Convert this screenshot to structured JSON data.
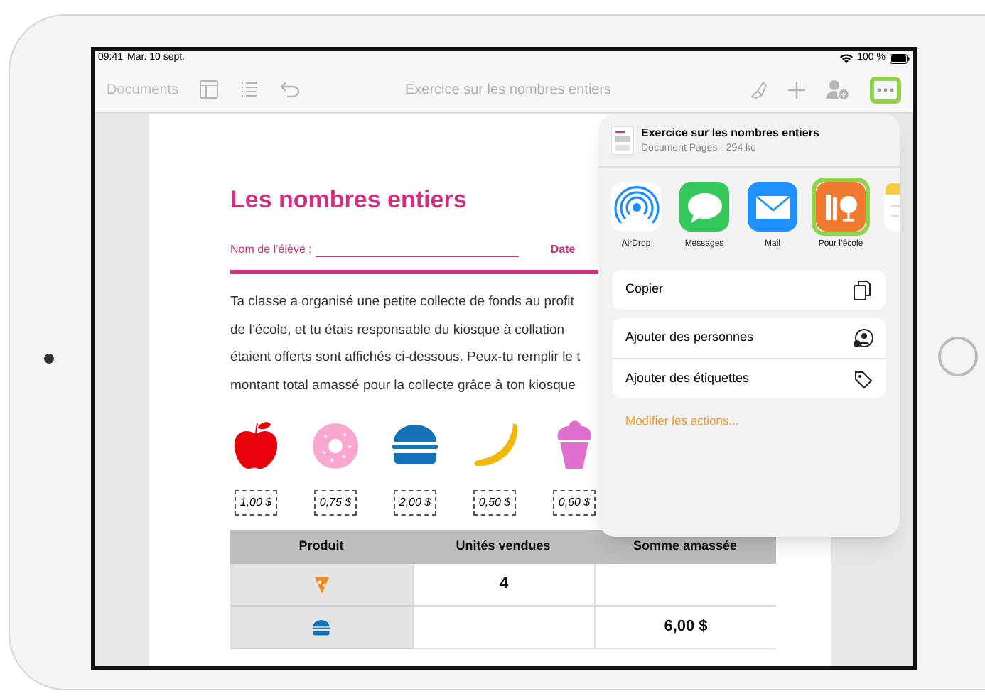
{
  "status_bar": {
    "time": "09:41",
    "date": "Mar. 10 sept.",
    "battery": "100 %"
  },
  "toolbar": {
    "back": "Documents",
    "title": "Exercice sur les nombres entiers",
    "more_highlighted": true
  },
  "document": {
    "title": "Les nombres entiers",
    "name_label": "Nom de l’élève :",
    "date_label": "Date",
    "paragraph_lines": [
      "Ta classe a organisé une petite collecte de fonds au profit",
      "de l’école, et tu étais responsable du kiosque à collation",
      "étaient offerts sont affichés ci-dessous. Peux-tu remplir le t",
      "montant total amassé pour la collecte grâce à ton kiosque"
    ],
    "items": [
      {
        "kind": "apple",
        "price": "1,00 $"
      },
      {
        "kind": "donut",
        "price": "0,75 $"
      },
      {
        "kind": "burger",
        "price": "2,00 $"
      },
      {
        "kind": "banana",
        "price": "0,50 $"
      },
      {
        "kind": "icecream",
        "price": "0,60 $"
      }
    ],
    "table": {
      "columns": [
        "Produit",
        "Unités vendues",
        "Somme amassée"
      ],
      "rows": [
        {
          "kind": "pizza",
          "units": "4"
        },
        {
          "kind": "burger",
          "amount": "6,00 $"
        }
      ]
    }
  },
  "share_sheet": {
    "title": "Exercice sur les nombres entiers",
    "subtitle": "Document Pages · 294 ko",
    "apps": [
      {
        "kind": "airdrop",
        "label": "AirDrop",
        "highlighted": false
      },
      {
        "kind": "messages",
        "label": "Messages",
        "highlighted": false
      },
      {
        "kind": "mail",
        "label": "Mail",
        "highlighted": false
      },
      {
        "kind": "school",
        "label": "Pour l’école",
        "highlighted": true
      },
      {
        "kind": "notes",
        "highlighted": false
      }
    ],
    "action_groups": [
      [
        {
          "kind": "copy",
          "label": "Copier"
        }
      ],
      [
        {
          "kind": "person-add",
          "label": "Ajouter des personnes"
        },
        {
          "kind": "tag",
          "label": "Ajouter des étiquettes"
        }
      ]
    ],
    "edit_link": "Modifier les actions..."
  }
}
